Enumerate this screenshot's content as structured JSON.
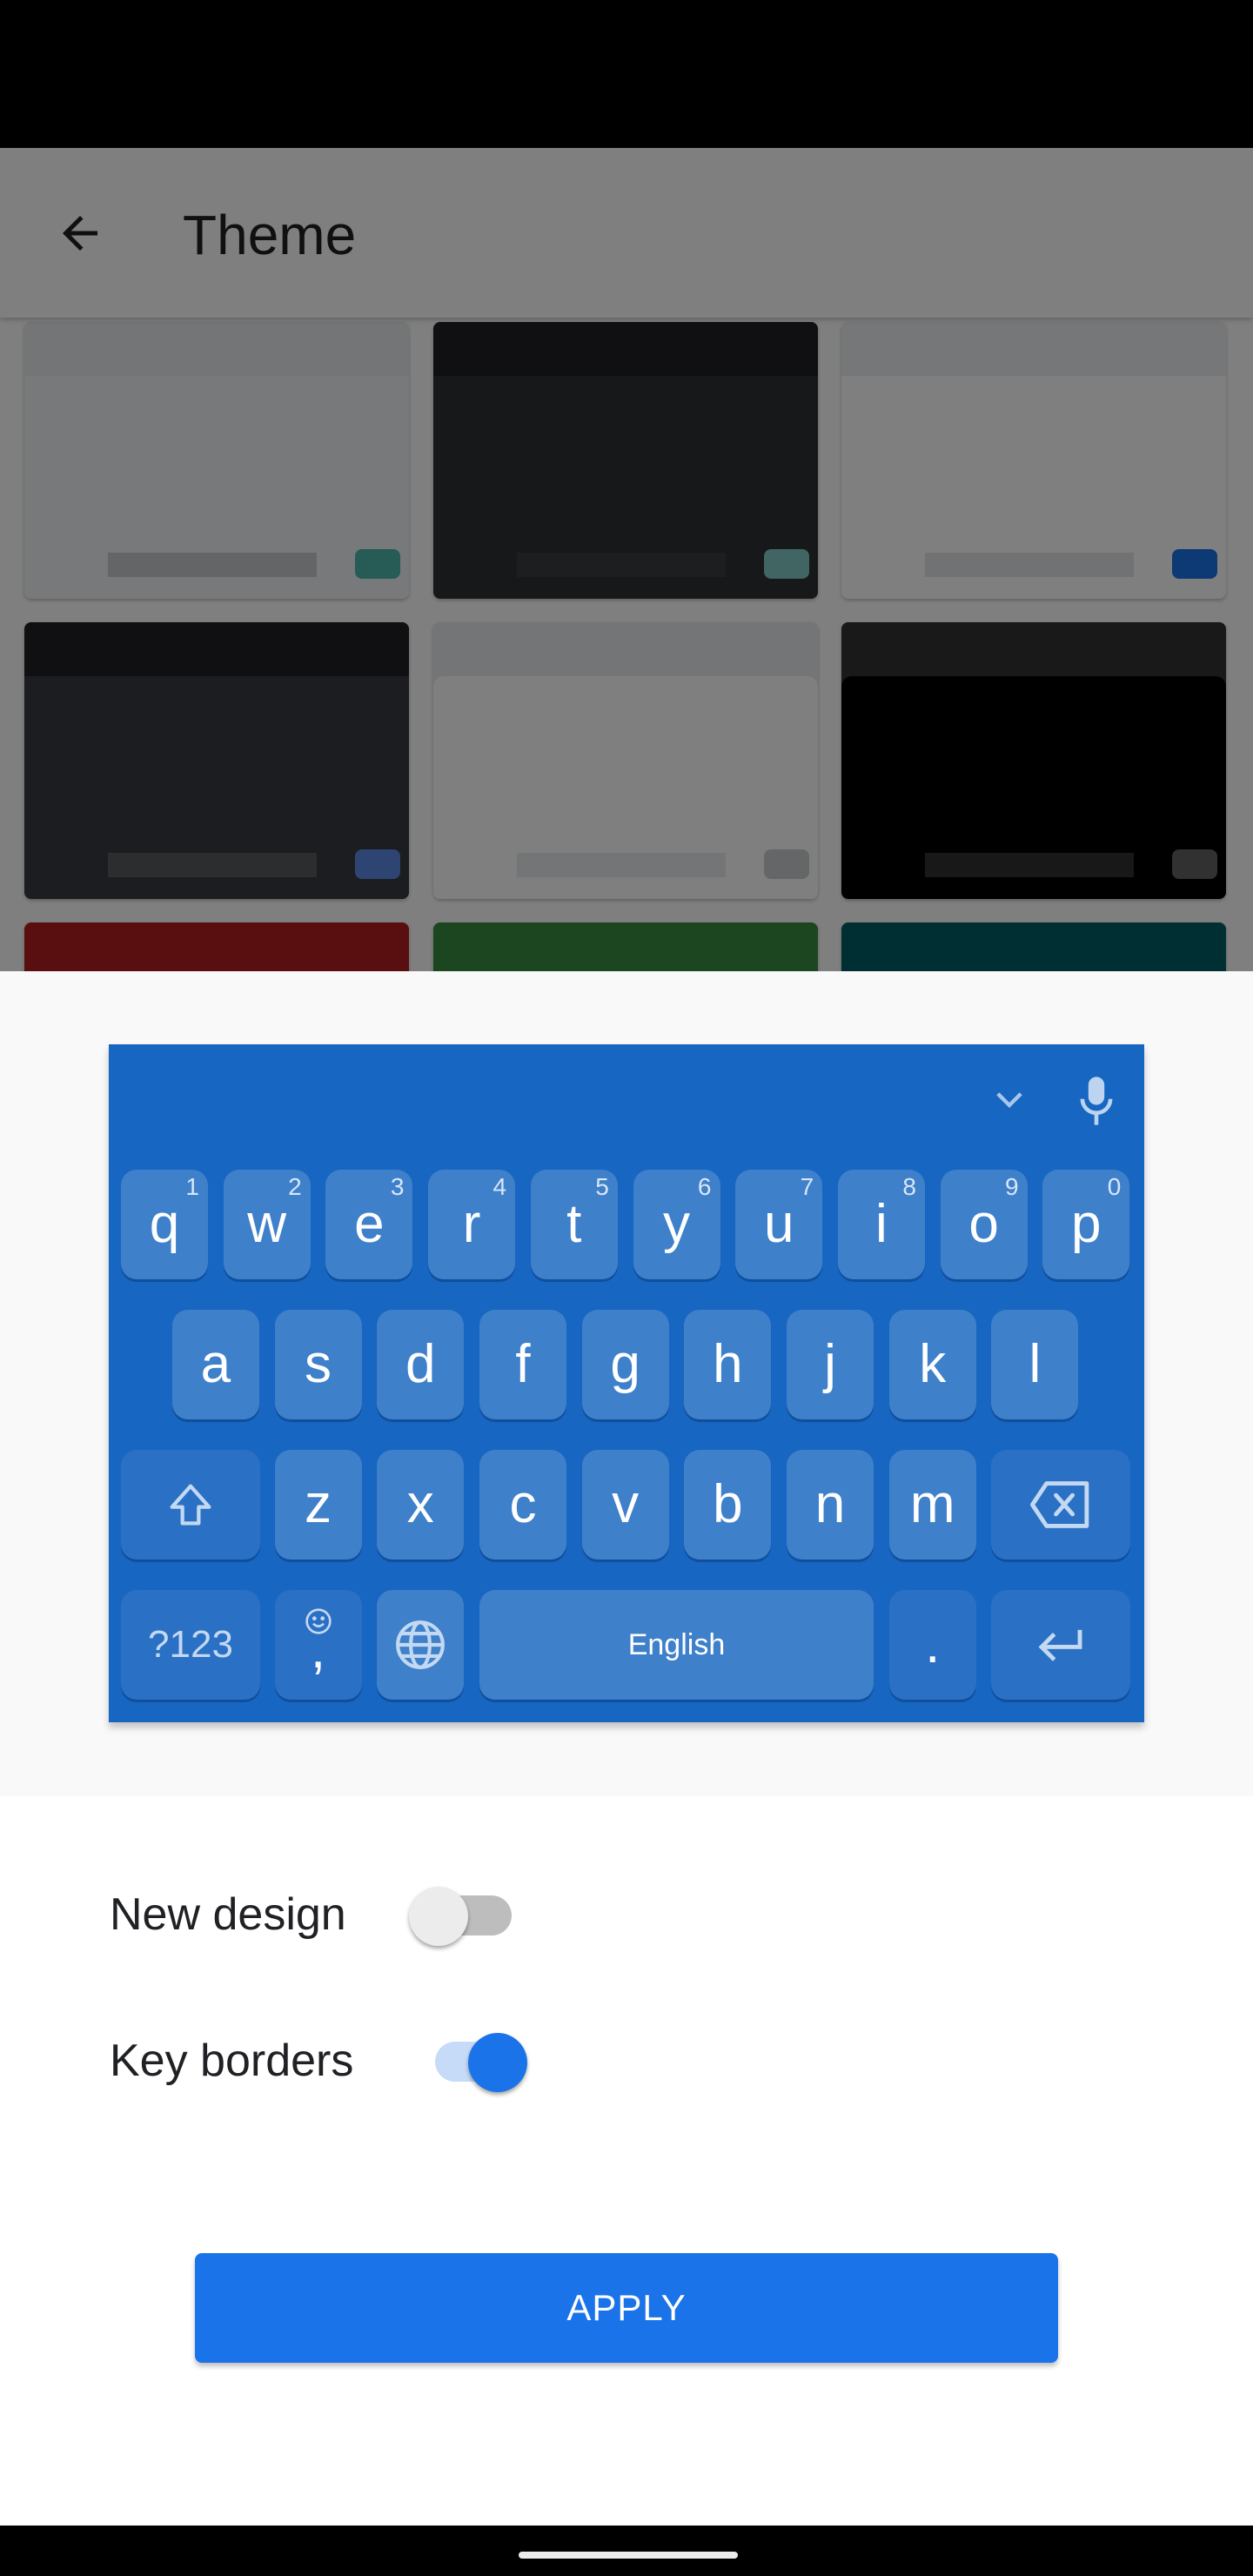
{
  "app_bar": {
    "title": "Theme",
    "back_icon": "arrow-back-icon"
  },
  "theme_tiles": [
    {
      "name": "light-teal",
      "top": "#e8eaed",
      "body": "#f1f3f4",
      "bar": "#c7cacd",
      "key": "#4db6ac",
      "rounded_body": false
    },
    {
      "name": "dark-teal",
      "top": "#202124",
      "body": "#2d3033",
      "bar": "#3a3d40",
      "key": "#80cbc4",
      "rounded_body": false
    },
    {
      "name": "light-blue",
      "top": "#eceef0",
      "body": "#ffffff",
      "bar": "#e2e4e6",
      "key": "#1a73e8",
      "rounded_body": false
    },
    {
      "name": "dark-blue",
      "top": "#202124",
      "body": "#393b40",
      "bar": "#575a5e",
      "key": "#5c8ae6",
      "rounded_body": false
    },
    {
      "name": "light-gray",
      "top": "#e8eaed",
      "body": "#ffffff",
      "bar": "#e8eaed",
      "key": "#c9ccd1",
      "rounded_body": true
    },
    {
      "name": "black",
      "top": "#323234",
      "body": "#000000",
      "bar": "#303032",
      "key": "#636365",
      "rounded_body": true
    },
    {
      "name": "red",
      "top": "#b31e1e",
      "body": "#b31e1e",
      "bar": "",
      "key": "",
      "rounded_body": false
    },
    {
      "name": "green",
      "top": "#398c3e",
      "body": "#398c3e",
      "bar": "",
      "key": "",
      "rounded_body": false
    },
    {
      "name": "teal",
      "top": "#005f66",
      "body": "#005f66",
      "bar": "",
      "key": "",
      "rounded_body": false
    }
  ],
  "keyboard_preview": {
    "background": "#1766c2",
    "toolbar_icons": [
      "chevron-down-icon",
      "microphone-icon"
    ],
    "row1": [
      {
        "key": "q",
        "hint": "1"
      },
      {
        "key": "w",
        "hint": "2"
      },
      {
        "key": "e",
        "hint": "3"
      },
      {
        "key": "r",
        "hint": "4"
      },
      {
        "key": "t",
        "hint": "5"
      },
      {
        "key": "y",
        "hint": "6"
      },
      {
        "key": "u",
        "hint": "7"
      },
      {
        "key": "i",
        "hint": "8"
      },
      {
        "key": "o",
        "hint": "9"
      },
      {
        "key": "p",
        "hint": "0"
      }
    ],
    "row2": [
      "a",
      "s",
      "d",
      "f",
      "g",
      "h",
      "j",
      "k",
      "l"
    ],
    "row3": [
      "z",
      "x",
      "c",
      "v",
      "b",
      "n",
      "m"
    ],
    "shift_icon": "shift-icon",
    "backspace_icon": "backspace-icon",
    "symbols_label": "?123",
    "comma_label": ",",
    "emoji_icon": "emoji-icon",
    "globe_icon": "globe-icon",
    "space_label": "English",
    "period_label": ".",
    "enter_icon": "enter-icon"
  },
  "settings": {
    "new_design": {
      "label": "New design",
      "on": false
    },
    "key_borders": {
      "label": "Key borders",
      "on": true
    }
  },
  "apply_button": {
    "label": "APPLY",
    "color": "#1a73e8"
  }
}
